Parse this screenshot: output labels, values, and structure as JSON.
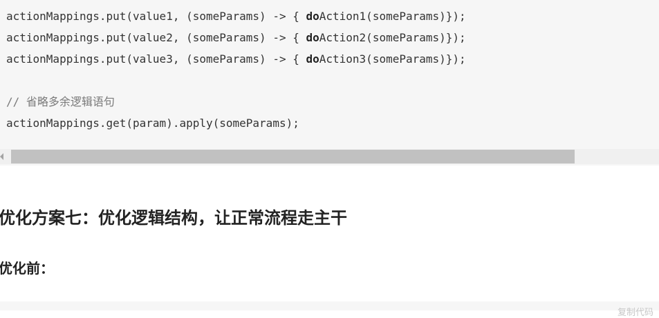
{
  "code_block": {
    "lines": [
      {
        "pre": "actionMappings.put(value1, (someParams) -> { ",
        "kw": "do",
        "post": "Action1(someParams)});"
      },
      {
        "pre": "actionMappings.put(value2, (someParams) -> { ",
        "kw": "do",
        "post": "Action2(someParams)});"
      },
      {
        "pre": "actionMappings.put(value3, (someParams) -> { ",
        "kw": "do",
        "post": "Action3(someParams)});"
      },
      {
        "comment": "// 省略多余逻辑语句"
      },
      {
        "plain": "actionMappings.get(param).apply(someParams);"
      }
    ]
  },
  "section": {
    "heading": "优化方案七：优化逻辑结构，让正常流程走主干",
    "subheading": "优化前："
  },
  "next_code": {
    "copy_label": "复制代码"
  }
}
